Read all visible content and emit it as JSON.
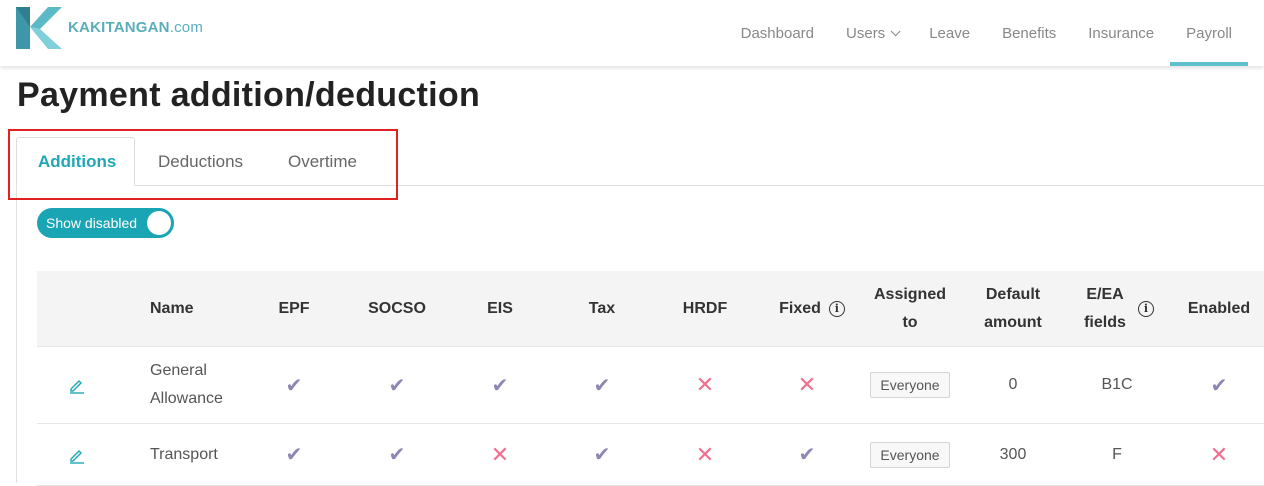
{
  "brand": {
    "name": "KAKITANGAN",
    "suffix": ".com"
  },
  "nav": [
    {
      "label": "Dashboard"
    },
    {
      "label": "Users",
      "dropdown": true
    },
    {
      "label": "Leave"
    },
    {
      "label": "Benefits"
    },
    {
      "label": "Insurance"
    },
    {
      "label": "Payroll",
      "active": true
    }
  ],
  "page_title": "Payment addition/deduction",
  "tabs": [
    {
      "label": "Additions",
      "active": true
    },
    {
      "label": "Deductions"
    },
    {
      "label": "Overtime"
    }
  ],
  "toggle": {
    "label": "Show disabled",
    "on": true
  },
  "table": {
    "headers": {
      "name": "Name",
      "epf": "EPF",
      "socso": "SOCSO",
      "eis": "EIS",
      "tax": "Tax",
      "hrdf": "HRDF",
      "fixed": "Fixed",
      "assigned_to": "Assigned to",
      "default_amount": "Default amount",
      "ea_fields": "E/EA fields",
      "enabled": "Enabled"
    },
    "rows": [
      {
        "name": "General Allowance",
        "epf": true,
        "socso": true,
        "eis": true,
        "tax": true,
        "hrdf": false,
        "fixed": false,
        "assigned_to": "Everyone",
        "default_amount": "0",
        "ea_fields": "B1C",
        "enabled": true
      },
      {
        "name": "Transport",
        "epf": true,
        "socso": true,
        "eis": false,
        "tax": true,
        "hrdf": false,
        "fixed": true,
        "assigned_to": "Everyone",
        "default_amount": "300",
        "ea_fields": "F",
        "enabled": false
      }
    ]
  },
  "colors": {
    "accent": "#19a5b4",
    "check": "#8f86b4",
    "cross": "#ef6f8e",
    "highlight": "#e32020"
  }
}
